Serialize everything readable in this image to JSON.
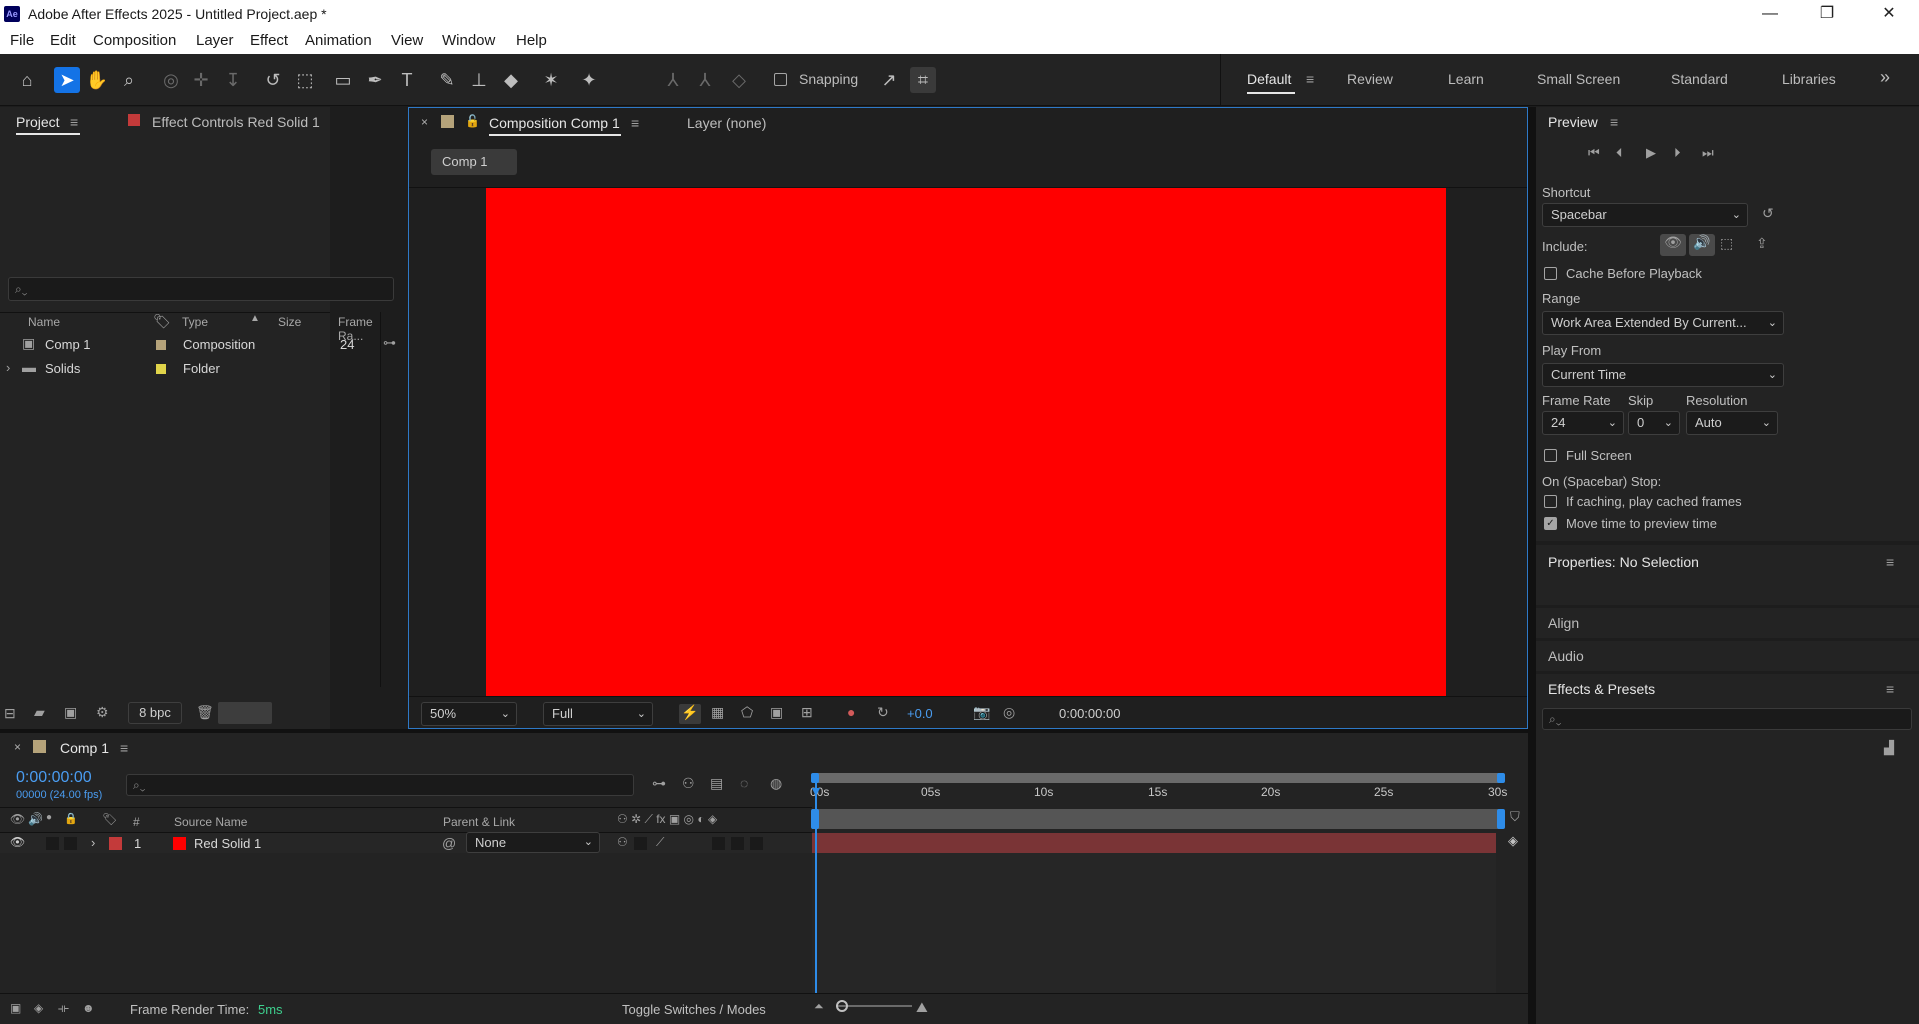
{
  "app": {
    "icon": "Ae",
    "title": "Adobe After Effects 2025 - Untitled Project.aep *"
  },
  "menu": [
    "File",
    "Edit",
    "Composition",
    "Layer",
    "Effect",
    "Animation",
    "View",
    "Window",
    "Help"
  ],
  "toolbar": {
    "snapping_label": "Snapping",
    "workspaces": [
      "Default",
      "Review",
      "Learn",
      "Small Screen",
      "Standard",
      "Libraries"
    ],
    "active_workspace": "Default"
  },
  "project_panel": {
    "tab_project": "Project",
    "tab_effect_controls": "Effect Controls Red Solid 1",
    "search_placeholder": "",
    "columns": [
      "Name",
      "Type",
      "Size",
      "Frame Ra..."
    ],
    "items": [
      {
        "name": "Comp 1",
        "type": "Composition",
        "size": "",
        "frame_rate": "24",
        "label_color": "#b5a37a",
        "icon": "composition-icon"
      },
      {
        "name": "Solids",
        "type": "Folder",
        "size": "",
        "frame_rate": "",
        "label_color": "#e0d44a",
        "icon": "folder-icon"
      }
    ],
    "bpc": "8 bpc"
  },
  "comp_viewer": {
    "tab_label": "Composition Comp 1",
    "layer_tab": "Layer (none)",
    "breadcrumb": "Comp 1",
    "solid_color": "#ff0000",
    "zoom": "50%",
    "resolution": "Full",
    "exposure": "+0.0",
    "timecode": "0:00:00:00"
  },
  "preview_panel": {
    "title": "Preview",
    "shortcut_label": "Shortcut",
    "shortcut_value": "Spacebar",
    "include_label": "Include:",
    "cache_before_playback": "Cache Before Playback",
    "range_label": "Range",
    "range_value": "Work Area Extended By Current...",
    "play_from_label": "Play From",
    "play_from_value": "Current Time",
    "frame_rate_label": "Frame Rate",
    "frame_rate_value": "24",
    "skip_label": "Skip",
    "skip_value": "0",
    "resolution_label": "Resolution",
    "resolution_value": "Auto",
    "full_screen": "Full Screen",
    "stop_label": "On (Spacebar) Stop:",
    "if_caching": "If caching, play cached frames",
    "move_time": "Move time to preview time",
    "move_time_checked": true
  },
  "properties_panel": {
    "title": "Properties: No Selection"
  },
  "align_panel": {
    "title": "Align"
  },
  "audio_panel": {
    "title": "Audio"
  },
  "effects_panel": {
    "title": "Effects & Presets"
  },
  "timeline": {
    "tab_label": "Comp 1",
    "timecode": "0:00:00:00",
    "frame_info": "00000 (24.00 fps)",
    "columns": {
      "num": "#",
      "source_name": "Source Name",
      "parent": "Parent & Link"
    },
    "ruler_labels": [
      "00s",
      "05s",
      "10s",
      "15s",
      "20s",
      "25s",
      "30s"
    ],
    "layers": [
      {
        "index": "1",
        "name": "Red Solid 1",
        "parent": "None",
        "label_color": "#c33a3a",
        "swatch_color": "#ff0000",
        "bar_color": "#7a3436"
      }
    ],
    "frame_render_label": "Frame Render Time:",
    "frame_render_value": "5ms",
    "toggle_label": "Toggle Switches / Modes"
  }
}
